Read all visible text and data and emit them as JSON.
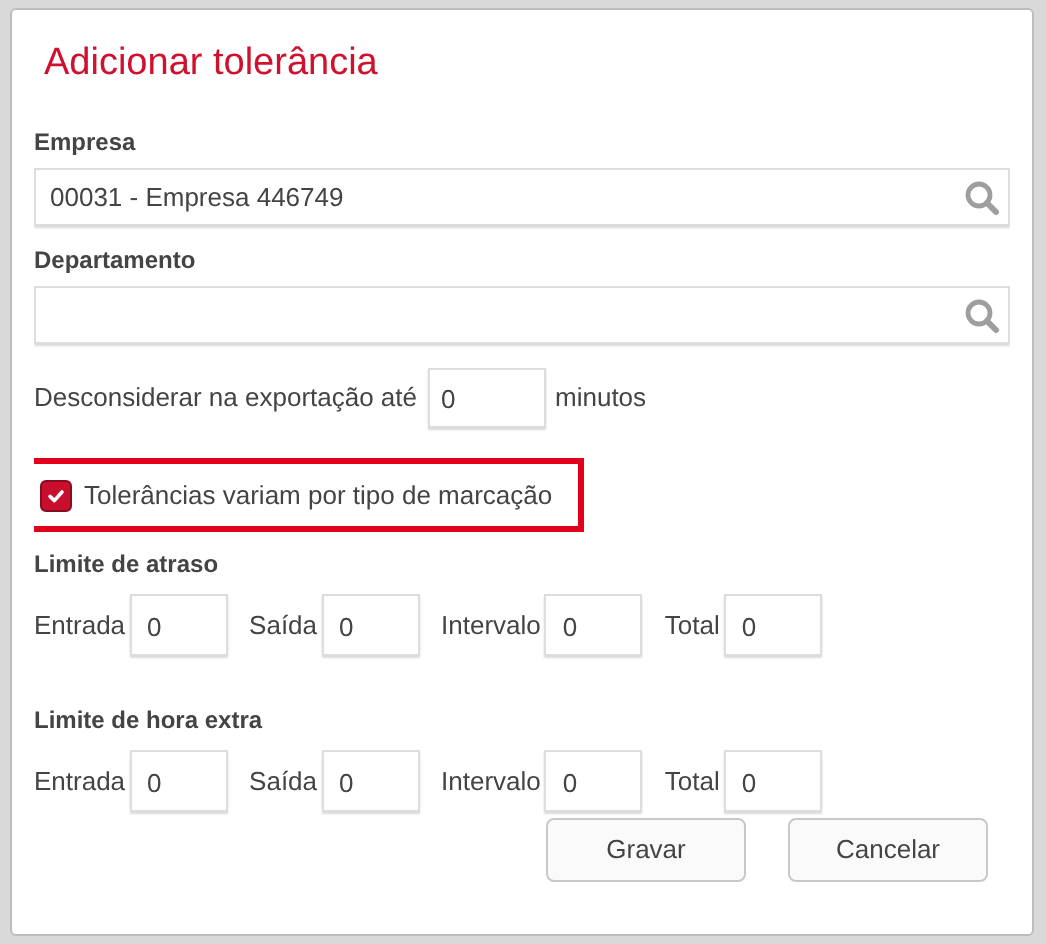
{
  "dialog": {
    "title": "Adicionar tolerância"
  },
  "fields": [
    {
      "label": "Empresa",
      "value": "00031 - Empresa 446749"
    },
    {
      "label": "Departamento"
    }
  ],
  "export": {
    "label": "Desconsiderar na exportação até",
    "value": "0",
    "unit": "minutos"
  },
  "option": {
    "label": "Tolerâncias variam por tipo de marcação",
    "checked": true,
    "highlighted": true
  },
  "groups": [
    {
      "title": "Limite de atraso",
      "inputs": [
        {
          "label": "Entrada",
          "value": "0"
        },
        {
          "label": "Saída",
          "value": "0"
        },
        {
          "label": "Intervalo",
          "value": "0"
        },
        {
          "label": "Total",
          "value": "0"
        }
      ]
    },
    {
      "title": "Limite de hora extra",
      "inputs": [
        {
          "label": "Entrada",
          "value": "0"
        },
        {
          "label": "Saída",
          "value": "0"
        },
        {
          "label": "Intervalo",
          "value": "0"
        },
        {
          "label": "Total",
          "value": "0"
        }
      ]
    }
  ],
  "buttons": [
    "Gravar",
    "Cancelar"
  ]
}
